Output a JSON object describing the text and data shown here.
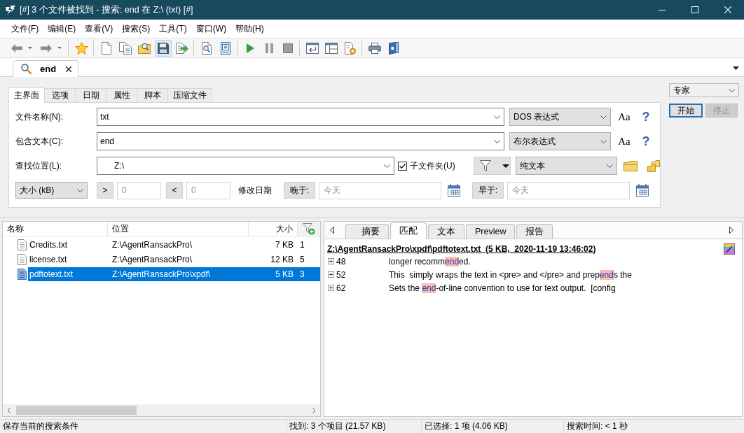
{
  "window": {
    "title": "[#] 3 个文件被找到 - 搜索: end 在 Z:\\ (txt) [#]"
  },
  "menu": [
    "文件(F)",
    "编辑(E)",
    "查看(V)",
    "搜索(S)",
    "工具(T)",
    "窗口(W)",
    "帮助(H)"
  ],
  "toolbar": [
    [
      {
        "kind": "back",
        "highlighted": false
      },
      {
        "kind": "forward",
        "highlighted": false
      }
    ],
    [
      {
        "kind": "favorite",
        "highlighted": false
      }
    ],
    [
      {
        "kind": "new",
        "highlighted": false
      },
      {
        "kind": "copy",
        "highlighted": false
      },
      {
        "kind": "open",
        "highlighted": false
      },
      {
        "kind": "save",
        "highlighted": true
      },
      {
        "kind": "export",
        "highlighted": false
      }
    ],
    [
      {
        "kind": "inspect",
        "highlighted": false
      },
      {
        "kind": "picture",
        "highlighted": false
      }
    ],
    [
      {
        "kind": "play",
        "highlighted": false
      },
      {
        "kind": "pause",
        "highlighted": false
      },
      {
        "kind": "stop",
        "highlighted": false
      }
    ],
    [
      {
        "kind": "window",
        "highlighted": false
      },
      {
        "kind": "layout",
        "highlighted": false
      },
      {
        "kind": "config",
        "highlighted": false
      }
    ],
    [
      {
        "kind": "print",
        "highlighted": false
      },
      {
        "kind": "help",
        "highlighted": false
      }
    ]
  ],
  "document_tabs": [
    {
      "label": "end",
      "selected": true
    }
  ],
  "search": {
    "tabs": [
      {
        "label": "主界面",
        "selected": true
      },
      {
        "label": "选项",
        "selected": false
      },
      {
        "label": "日期",
        "selected": false
      },
      {
        "label": "属性",
        "selected": false
      },
      {
        "label": "脚本",
        "selected": false
      },
      {
        "label": "压缩文件",
        "selected": false
      }
    ],
    "rows": [
      {
        "kind": "pattern",
        "label": "文件名称(N):",
        "value": "txt",
        "mode": "DOS 表达式",
        "case": "Aa",
        "help": "?"
      },
      {
        "kind": "pattern",
        "label": "包含文本(C):",
        "value": "end",
        "mode": "布尔表达式",
        "case": "Aa",
        "help": "?"
      },
      {
        "kind": "location",
        "label": "查找位置(L):",
        "value": "Z:\\",
        "subfolders": {
          "label": "子文件夹(U)",
          "checked": true
        },
        "mode": "纯文本"
      },
      {
        "kind": "size_date",
        "unit": "大小 (kB)",
        "greater": {
          "label": ">",
          "placeholder": "0"
        },
        "less": {
          "label": "<",
          "placeholder": "0"
        },
        "date_label": "修改日期",
        "after": {
          "label": "晚于:",
          "placeholder": "今天"
        },
        "before": {
          "label": "早于:",
          "placeholder": "今天"
        }
      }
    ],
    "mode": "专家",
    "buttons": [
      {
        "label": "开始",
        "default": true,
        "disabled": false
      },
      {
        "label": "停止",
        "default": false,
        "disabled": true
      }
    ]
  },
  "results": {
    "columns": [
      "名称",
      "位置",
      "大小"
    ],
    "rows": [
      {
        "name": "Credits.txt",
        "location": "Z:\\AgentRansackPro\\",
        "size": "7 KB",
        "column_4": "1",
        "selected": false
      },
      {
        "name": "license.txt",
        "location": "Z:\\AgentRansackPro\\",
        "size": "12 KB",
        "column_4": "5",
        "selected": false
      },
      {
        "name": "pdftotext.txt",
        "location": "Z:\\AgentRansackPro\\xpdf\\",
        "size": "5 KB",
        "column_4": "3",
        "selected": true
      }
    ]
  },
  "preview": {
    "tabs": [
      {
        "label": "摘要",
        "selected": false
      },
      {
        "label": "匹配",
        "selected": true
      },
      {
        "label": "文本",
        "selected": false
      },
      {
        "label": "Preview",
        "selected": false
      },
      {
        "label": "报告",
        "selected": false
      }
    ],
    "header": "Z:\\AgentRansackPro\\xpdf\\pdftotext.txt  (5 KB,  2020-11-19 13:46:02)",
    "matches": [
      {
        "line": "48",
        "expanded": false,
        "parts": [
          {
            "text": "longer recomm",
            "match": false
          },
          {
            "text": "end",
            "match": true
          },
          {
            "text": "ed.",
            "match": false
          }
        ]
      },
      {
        "line": "52",
        "expanded": false,
        "parts": [
          {
            "text": "This  simply wraps the text in <pre> and </pre> and prep",
            "match": false
          },
          {
            "text": "end",
            "match": true
          },
          {
            "text": "s the",
            "match": false
          }
        ]
      },
      {
        "line": "62",
        "expanded": false,
        "parts": [
          {
            "text": "Sets the ",
            "match": false
          },
          {
            "text": "end",
            "match": true
          },
          {
            "text": "-of-line convention to use for text output.  [config",
            "match": false
          }
        ]
      }
    ]
  },
  "status_bar": [
    "保存当前的搜索条件",
    "找到: 3 个项目 (21.57 KB)",
    "已选择: 1 项 (4.06 KB)",
    "搜索时间: < 1 秒"
  ]
}
